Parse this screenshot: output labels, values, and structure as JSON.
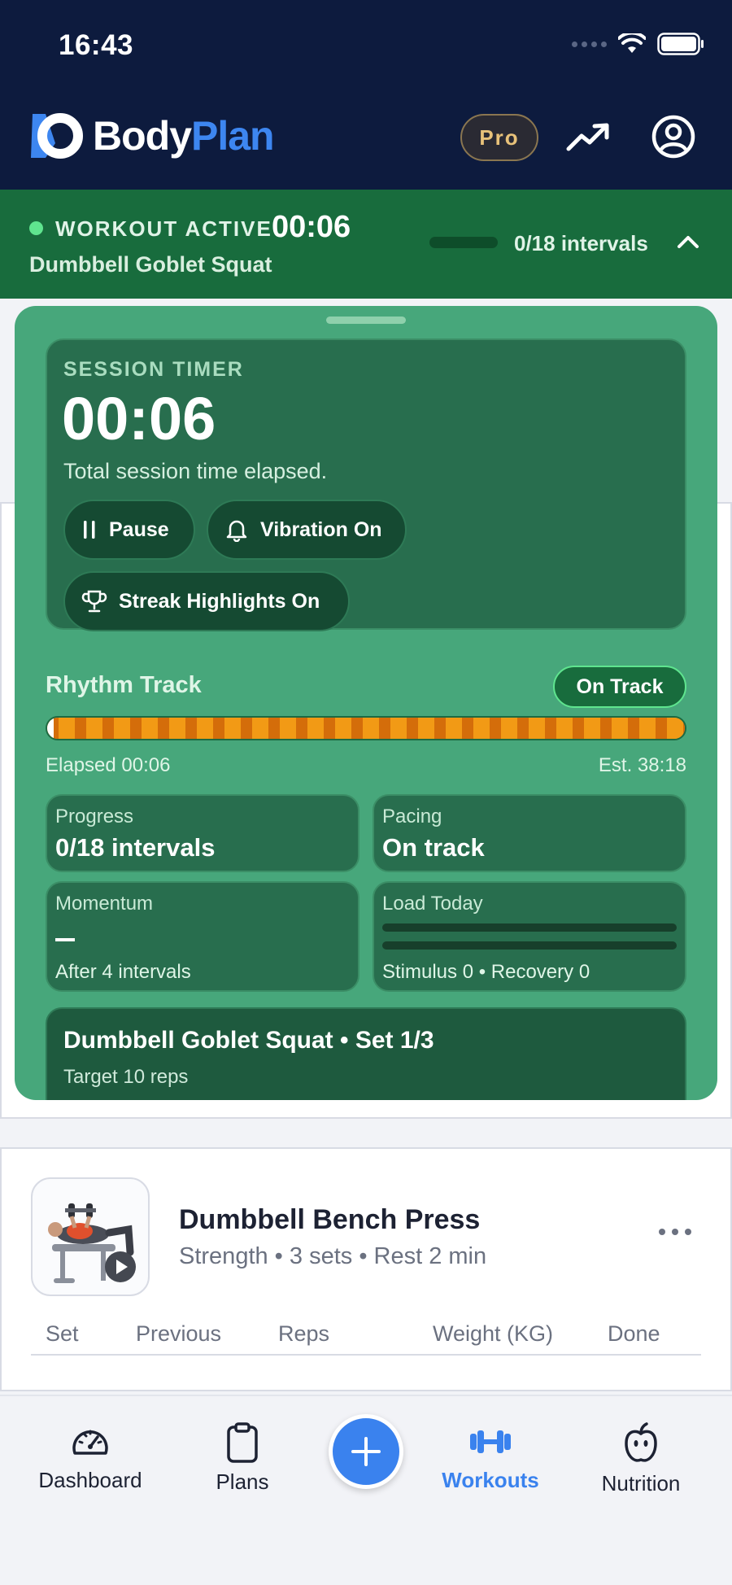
{
  "status_bar": {
    "time": "16:43"
  },
  "header": {
    "logo_body": "Body",
    "logo_plan": "Plan",
    "pro_label": "Pro",
    "icons": [
      "trend-up-icon",
      "profile-icon"
    ]
  },
  "active_banner": {
    "label": "WORKOUT ACTIVE",
    "time": "00:06",
    "exercise": "Dumbbell Goblet Squat",
    "intervals": "0/18 intervals",
    "accent": "#5fe58f"
  },
  "session": {
    "label": "SESSION TIMER",
    "time": "00:06",
    "description": "Total session time elapsed.",
    "buttons": {
      "pause": "Pause",
      "vibration": "Vibration On",
      "streak": "Streak Highlights On"
    }
  },
  "rhythm": {
    "title": "Rhythm Track",
    "badge": "On Track",
    "elapsed": "Elapsed 00:06",
    "estimate": "Est. 38:18"
  },
  "stats": {
    "progress_label": "Progress",
    "progress_value": "0/18 intervals",
    "pacing_label": "Pacing",
    "pacing_value": "On track",
    "momentum_label": "Momentum",
    "momentum_foot": "After 4 intervals",
    "load_label": "Load Today",
    "load_foot": "Stimulus 0 • Recovery 0"
  },
  "current_exercise": {
    "title": "Dumbbell Goblet Squat • Set 1/3",
    "subtitle": "Target 10 reps"
  },
  "next_exercise": {
    "title": "Dumbbell Bench Press",
    "subtitle": "Strength • 3 sets • Rest 2 min",
    "columns": [
      "Set",
      "Previous",
      "Reps",
      "Weight (KG)",
      "Done"
    ]
  },
  "bottom_nav": {
    "items": [
      {
        "label": "Dashboard",
        "icon": "gauge-icon"
      },
      {
        "label": "Plans",
        "icon": "clipboard-icon"
      },
      {
        "label": "Workouts",
        "icon": "dumbbell-icon",
        "active": true
      },
      {
        "label": "Nutrition",
        "icon": "apple-icon"
      }
    ],
    "fab_icon": "plus-icon",
    "accent": "#3a82ee"
  }
}
